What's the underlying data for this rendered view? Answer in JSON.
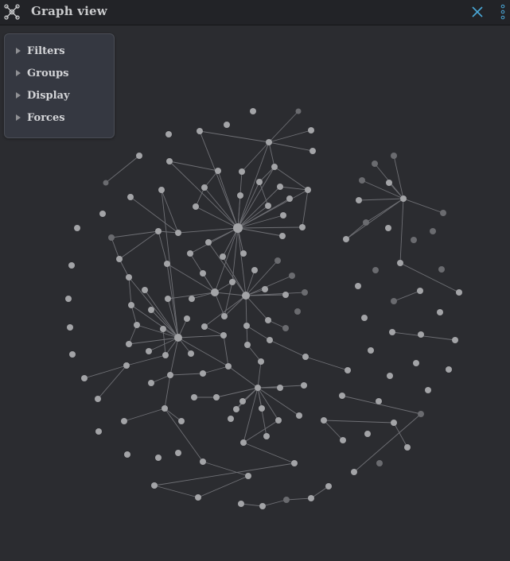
{
  "window": {
    "title": "Graph view",
    "app_icon": "graph-icon",
    "close_icon": "close-icon",
    "more_icon": "more-options-icon",
    "accent_color": "#4aa8d8"
  },
  "panel": {
    "items": [
      {
        "label": "Filters",
        "icon": "caret-right-icon"
      },
      {
        "label": "Groups",
        "icon": "caret-right-icon"
      },
      {
        "label": "Display",
        "icon": "caret-right-icon"
      },
      {
        "label": "Forces",
        "icon": "caret-right-icon"
      }
    ]
  },
  "graph": {
    "node_color": "#a3a4a7",
    "dim_node_color": "#6a6b6f",
    "edge_color": "#6f7075"
  }
}
